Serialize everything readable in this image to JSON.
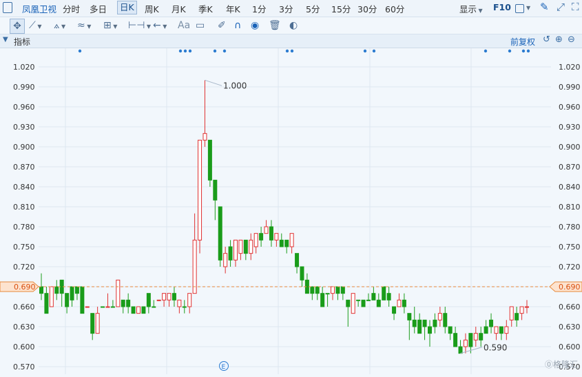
{
  "toolbar": {
    "stock_name": "凤凰卫视",
    "periods": [
      "分时",
      "多日",
      "日K",
      "周K",
      "月K",
      "季K",
      "年K",
      "1分",
      "3分",
      "5分",
      "15分",
      "30分",
      "60分"
    ],
    "selected_period": "日K",
    "display_label": "显示",
    "f10_label": "F10"
  },
  "indicator_bar": {
    "label": "指标",
    "adjust_label": "前复权"
  },
  "chart_data": {
    "type": "candlestick",
    "ylim": [
      0.57,
      1.02
    ],
    "y_ticks": [
      "1.020",
      "0.990",
      "0.960",
      "0.930",
      "0.900",
      "0.870",
      "0.840",
      "0.810",
      "0.780",
      "0.750",
      "0.720",
      "0.690",
      "0.660",
      "0.630",
      "0.600",
      "0.570"
    ],
    "current_price": "0.690",
    "high_annotation": "1.000",
    "low_annotation": "0.590",
    "event_marker": "E",
    "colors": {
      "up": "#e03030",
      "down": "#1a9c1a",
      "current_line": "#e7893b",
      "grid": "#dde7f1"
    },
    "candles": [
      [
        0.69,
        0.68,
        0.71,
        0.67
      ],
      [
        0.68,
        0.65,
        0.69,
        0.65
      ],
      [
        0.66,
        0.69,
        0.69,
        0.66
      ],
      [
        0.69,
        0.68,
        0.7,
        0.67
      ],
      [
        0.7,
        0.68,
        0.7,
        0.66
      ],
      [
        0.68,
        0.66,
        0.68,
        0.65
      ],
      [
        0.69,
        0.67,
        0.69,
        0.66
      ],
      [
        0.69,
        0.68,
        0.69,
        0.67
      ],
      [
        0.69,
        0.65,
        0.69,
        0.65
      ],
      [
        0.66,
        0.66,
        0.66,
        0.66
      ],
      [
        0.65,
        0.62,
        0.65,
        0.61
      ],
      [
        0.62,
        0.65,
        0.66,
        0.62
      ],
      [
        0.66,
        0.66,
        0.66,
        0.66
      ],
      [
        0.66,
        0.66,
        0.68,
        0.66
      ],
      [
        0.66,
        0.66,
        0.67,
        0.66
      ],
      [
        0.66,
        0.7,
        0.7,
        0.66
      ],
      [
        0.67,
        0.66,
        0.67,
        0.65
      ],
      [
        0.67,
        0.66,
        0.68,
        0.65
      ],
      [
        0.66,
        0.65,
        0.66,
        0.65
      ],
      [
        0.65,
        0.66,
        0.66,
        0.65
      ],
      [
        0.66,
        0.65,
        0.66,
        0.65
      ],
      [
        0.68,
        0.66,
        0.68,
        0.65
      ],
      [
        0.66,
        0.66,
        0.67,
        0.66
      ],
      [
        0.67,
        0.67,
        0.67,
        0.67
      ],
      [
        0.67,
        0.68,
        0.68,
        0.66
      ],
      [
        0.67,
        0.68,
        0.68,
        0.66
      ],
      [
        0.68,
        0.67,
        0.69,
        0.66
      ],
      [
        0.66,
        0.67,
        0.67,
        0.65
      ],
      [
        0.66,
        0.66,
        0.67,
        0.65
      ],
      [
        0.66,
        0.68,
        0.68,
        0.65
      ],
      [
        0.68,
        0.76,
        0.8,
        0.68
      ],
      [
        0.76,
        0.91,
        0.91,
        0.74
      ],
      [
        0.91,
        0.92,
        1.0,
        0.9
      ],
      [
        0.91,
        0.85,
        0.91,
        0.84
      ],
      [
        0.85,
        0.82,
        0.85,
        0.79
      ],
      [
        0.81,
        0.73,
        0.81,
        0.72
      ],
      [
        0.72,
        0.74,
        0.75,
        0.71
      ],
      [
        0.75,
        0.73,
        0.76,
        0.72
      ],
      [
        0.73,
        0.76,
        0.76,
        0.72
      ],
      [
        0.74,
        0.76,
        0.76,
        0.73
      ],
      [
        0.76,
        0.74,
        0.76,
        0.73
      ],
      [
        0.74,
        0.76,
        0.77,
        0.73
      ],
      [
        0.75,
        0.77,
        0.77,
        0.74
      ],
      [
        0.77,
        0.76,
        0.78,
        0.75
      ],
      [
        0.77,
        0.78,
        0.79,
        0.77
      ],
      [
        0.78,
        0.76,
        0.79,
        0.75
      ],
      [
        0.76,
        0.77,
        0.77,
        0.75
      ],
      [
        0.76,
        0.75,
        0.77,
        0.75
      ],
      [
        0.76,
        0.75,
        0.76,
        0.74
      ],
      [
        0.75,
        0.77,
        0.77,
        0.74
      ],
      [
        0.74,
        0.72,
        0.74,
        0.71
      ],
      [
        0.72,
        0.7,
        0.72,
        0.69
      ],
      [
        0.7,
        0.68,
        0.71,
        0.68
      ],
      [
        0.69,
        0.68,
        0.69,
        0.67
      ],
      [
        0.69,
        0.68,
        0.69,
        0.67
      ],
      [
        0.68,
        0.66,
        0.69,
        0.66
      ],
      [
        0.68,
        0.68,
        0.68,
        0.66
      ],
      [
        0.68,
        0.69,
        0.69,
        0.67
      ],
      [
        0.69,
        0.68,
        0.69,
        0.67
      ],
      [
        0.69,
        0.68,
        0.69,
        0.67
      ],
      [
        0.67,
        0.66,
        0.67,
        0.63
      ],
      [
        0.65,
        0.68,
        0.68,
        0.65
      ],
      [
        0.67,
        0.67,
        0.67,
        0.66
      ],
      [
        0.67,
        0.66,
        0.67,
        0.66
      ],
      [
        0.67,
        0.67,
        0.68,
        0.67
      ],
      [
        0.68,
        0.67,
        0.69,
        0.67
      ],
      [
        0.67,
        0.66,
        0.68,
        0.66
      ],
      [
        0.69,
        0.67,
        0.69,
        0.67
      ],
      [
        0.68,
        0.67,
        0.69,
        0.66
      ],
      [
        0.66,
        0.65,
        0.66,
        0.64
      ],
      [
        0.66,
        0.67,
        0.68,
        0.66
      ],
      [
        0.67,
        0.66,
        0.68,
        0.65
      ],
      [
        0.65,
        0.64,
        0.65,
        0.61
      ],
      [
        0.64,
        0.63,
        0.66,
        0.62
      ],
      [
        0.64,
        0.62,
        0.65,
        0.62
      ],
      [
        0.64,
        0.63,
        0.64,
        0.61
      ],
      [
        0.63,
        0.62,
        0.64,
        0.6
      ],
      [
        0.64,
        0.63,
        0.65,
        0.62
      ],
      [
        0.64,
        0.65,
        0.66,
        0.63
      ],
      [
        0.65,
        0.63,
        0.66,
        0.62
      ],
      [
        0.63,
        0.62,
        0.63,
        0.61
      ],
      [
        0.62,
        0.6,
        0.63,
        0.6
      ],
      [
        0.6,
        0.59,
        0.61,
        0.59
      ],
      [
        0.6,
        0.61,
        0.62,
        0.59
      ],
      [
        0.62,
        0.6,
        0.62,
        0.59
      ],
      [
        0.61,
        0.62,
        0.63,
        0.6
      ],
      [
        0.62,
        0.61,
        0.63,
        0.6
      ],
      [
        0.63,
        0.62,
        0.64,
        0.62
      ],
      [
        0.64,
        0.63,
        0.65,
        0.62
      ],
      [
        0.62,
        0.63,
        0.63,
        0.61
      ],
      [
        0.63,
        0.62,
        0.63,
        0.61
      ],
      [
        0.62,
        0.63,
        0.64,
        0.61
      ],
      [
        0.64,
        0.66,
        0.66,
        0.63
      ],
      [
        0.65,
        0.64,
        0.66,
        0.63
      ],
      [
        0.65,
        0.66,
        0.66,
        0.64
      ],
      [
        0.66,
        0.66,
        0.67,
        0.65
      ]
    ]
  }
}
